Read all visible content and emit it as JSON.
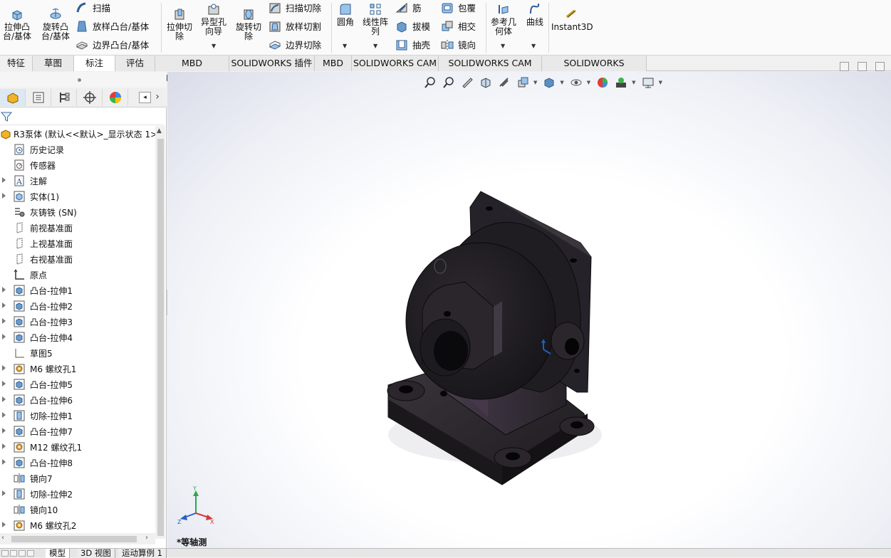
{
  "ribbon": {
    "extrude_boss": "拉伸凸\n台/基体",
    "revolve_boss": "旋转凸\n台/基体",
    "sweep": "扫描",
    "loft_boss": "放样凸台/基体",
    "boundary_boss": "边界凸台/基体",
    "extrude_cut": "拉伸切\n除",
    "hole_wizard": "异型孔\n向导",
    "revolve_cut": "旋转切\n除",
    "sweep_cut": "扫描切除",
    "loft_cut": "放样切割",
    "boundary_cut": "边界切除",
    "fillet": "圆角",
    "linear_pattern": "线性阵\n列",
    "rib": "筋",
    "draft": "拔模",
    "shell": "抽壳",
    "wrap": "包覆",
    "intersect": "相交",
    "mirror": "镜向",
    "ref_geometry": "参考几\n何体",
    "curves": "曲线",
    "instant3d": "Instant3D"
  },
  "tabs": [
    "特征",
    "草图",
    "标注",
    "评估",
    "MBD Dimensions",
    "SOLIDWORKS 插件",
    "MBD",
    "SOLIDWORKS CAM",
    "SOLIDWORKS CAM TBM",
    "SOLIDWORKS Inspection"
  ],
  "active_tab": "标注",
  "tree": {
    "root": "R3泵体  (默认<<默认>_显示状态 1>",
    "items": [
      {
        "label": "历史记录",
        "icon": "history-icon",
        "expandable": false
      },
      {
        "label": "传感器",
        "icon": "sensor-icon",
        "expandable": false
      },
      {
        "label": "注解",
        "icon": "annotation-icon",
        "expandable": true
      },
      {
        "label": "实体(1)",
        "icon": "solid-body-icon",
        "expandable": true
      },
      {
        "label": "灰铸铁 (SN)",
        "icon": "material-icon",
        "expandable": false
      },
      {
        "label": "前视基准面",
        "icon": "plane-icon",
        "expandable": false
      },
      {
        "label": "上视基准面",
        "icon": "plane-icon",
        "expandable": false
      },
      {
        "label": "右视基准面",
        "icon": "plane-icon",
        "expandable": false
      },
      {
        "label": "原点",
        "icon": "origin-icon",
        "expandable": false
      },
      {
        "label": "凸台-拉伸1",
        "icon": "extrude-icon",
        "expandable": true
      },
      {
        "label": "凸台-拉伸2",
        "icon": "extrude-icon",
        "expandable": true
      },
      {
        "label": "凸台-拉伸3",
        "icon": "extrude-icon",
        "expandable": true
      },
      {
        "label": "凸台-拉伸4",
        "icon": "extrude-icon",
        "expandable": true
      },
      {
        "label": "草图5",
        "icon": "sketch-icon",
        "expandable": false
      },
      {
        "label": "M6 螺纹孔1",
        "icon": "hole-icon",
        "expandable": true
      },
      {
        "label": "凸台-拉伸5",
        "icon": "extrude-icon",
        "expandable": true
      },
      {
        "label": "凸台-拉伸6",
        "icon": "extrude-icon",
        "expandable": true
      },
      {
        "label": "切除-拉伸1",
        "icon": "cut-icon",
        "expandable": true
      },
      {
        "label": "凸台-拉伸7",
        "icon": "extrude-icon",
        "expandable": true
      },
      {
        "label": "M12 螺纹孔1",
        "icon": "hole-icon",
        "expandable": true
      },
      {
        "label": "凸台-拉伸8",
        "icon": "extrude-icon",
        "expandable": true
      },
      {
        "label": "镜向7",
        "icon": "mirror-icon",
        "expandable": false
      },
      {
        "label": "切除-拉伸2",
        "icon": "cut-icon",
        "expandable": true
      },
      {
        "label": "镜向10",
        "icon": "mirror-icon",
        "expandable": false
      },
      {
        "label": "M6 螺纹孔2",
        "icon": "hole-icon",
        "expandable": true
      }
    ]
  },
  "viewport": {
    "view_name": "*等轴测",
    "triad": {
      "x": "X",
      "y": "Y",
      "z": "Z"
    }
  },
  "bottom_tabs": [
    "模型",
    "3D 视图",
    "运动算例 1"
  ],
  "active_bottom_tab": "模型",
  "colors": {
    "part": "#2a262b",
    "accent": "#1f5fbf"
  }
}
